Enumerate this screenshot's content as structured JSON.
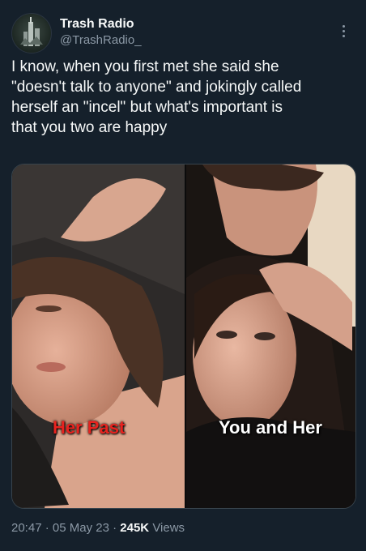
{
  "author": {
    "display_name": "Trash Radio",
    "handle": "@TrashRadio_",
    "avatar_icon": "city-tower-avatar-icon"
  },
  "tweet": {
    "text_lines": [
      "I know, when you first met she said she",
      "\"doesn't talk to anyone\" and jokingly called",
      "herself an \"incel\" but what's important is",
      "that you two are happy"
    ]
  },
  "media": {
    "left_caption": "Her Past",
    "right_caption": "You and Her",
    "left_caption_color": "#e8231f",
    "right_caption_color": "#ffffff"
  },
  "meta": {
    "time": "20:47",
    "separator": "·",
    "date": "05 May 23",
    "views_count": "245K",
    "views_label": "Views"
  },
  "colors": {
    "background": "#15202b",
    "text_primary": "#f7f9f9",
    "text_secondary": "#8b98a5"
  }
}
